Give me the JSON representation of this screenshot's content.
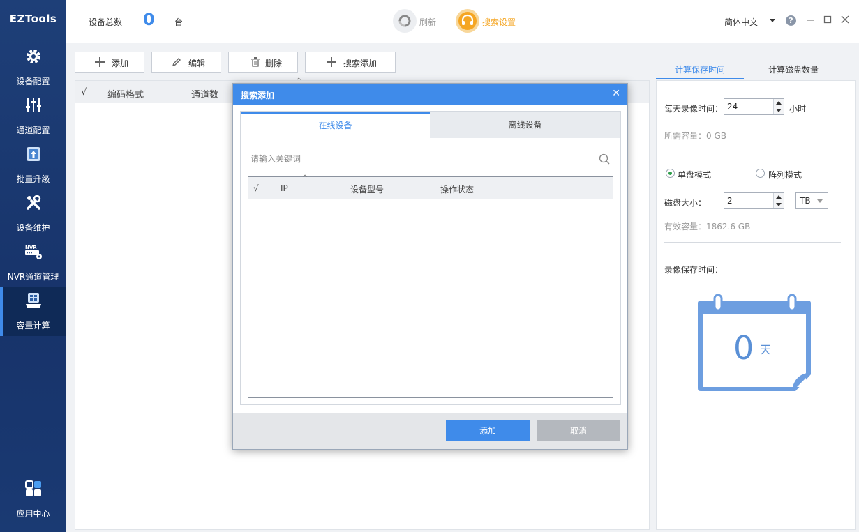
{
  "app": {
    "logo": "EZTools"
  },
  "sidebar": {
    "items": [
      {
        "label": "设备配置",
        "icon": "gear-icon"
      },
      {
        "label": "通道配置",
        "icon": "sliders-icon"
      },
      {
        "label": "批量升级",
        "icon": "upgrade-icon"
      },
      {
        "label": "设备维护",
        "icon": "tools-icon"
      },
      {
        "label": "NVR通道管理",
        "icon": "nvr-icon"
      },
      {
        "label": "容量计算",
        "icon": "calculator-icon"
      }
    ],
    "bottom": {
      "label": "应用中心",
      "icon": "apps-icon"
    },
    "active_index": 5
  },
  "topbar": {
    "device_total_label": "设备总数",
    "device_count": "0",
    "unit": "台",
    "refresh_label": "刷新",
    "search_settings_label": "搜索设置",
    "language": "简体中文",
    "help": "?"
  },
  "toolbar": {
    "add_label": "添加",
    "edit_label": "编辑",
    "delete_label": "删除",
    "search_add_label": "搜索添加"
  },
  "main_table": {
    "columns": [
      "√",
      "编码格式",
      "通道数"
    ]
  },
  "right_panel": {
    "tabs": [
      "计算保存时间",
      "计算磁盘数量"
    ],
    "daily_record_label": "每天录像时间：",
    "daily_record_value": "24",
    "daily_record_unit": "小时",
    "required_capacity": "所需容量：0 GB",
    "mode_single": "单盘模式",
    "mode_array": "阵列模式",
    "disk_size_label": "磁盘大小：",
    "disk_size_value": "2",
    "disk_unit": "TB",
    "effective_capacity": "有效容量：1862.6 GB",
    "retention_label": "录像保存时间：",
    "retention_days": "0",
    "retention_unit": "天"
  },
  "dialog": {
    "title": "搜索添加",
    "close": "✕",
    "tabs": [
      "在线设备",
      "离线设备"
    ],
    "search_placeholder": "请输入关键词",
    "columns": [
      "√",
      "IP",
      "设备型号",
      "操作状态"
    ],
    "add_button": "添加",
    "cancel_button": "取消"
  },
  "colors": {
    "accent": "#3f8bea",
    "sidebar_bg": "#1e3f78",
    "search_settings": "#f5a623"
  }
}
